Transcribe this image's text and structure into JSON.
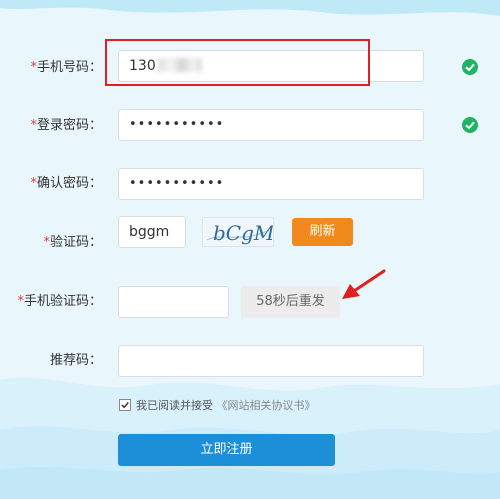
{
  "form": {
    "phone": {
      "required_mark": "*",
      "label": "手机号码：",
      "value_prefix": "130"
    },
    "password": {
      "required_mark": "*",
      "label": "登录密码：",
      "value": "•••••••••••"
    },
    "confirm": {
      "required_mark": "*",
      "label": "确认密码：",
      "value": "•••••••••••"
    },
    "captcha": {
      "required_mark": "*",
      "label": "验证码：",
      "value": "bggm",
      "image_text": "bCgM",
      "refresh_label": "刷新"
    },
    "sms": {
      "required_mark": "*",
      "label": "手机验证码：",
      "value": "",
      "resend_label": "58秒后重发"
    },
    "referral": {
      "label": "推荐码：",
      "value": ""
    },
    "agreement": {
      "checked": true,
      "text": "我已阅读并接受",
      "link": "《网站相关协议书》"
    },
    "submit_label": "立即注册"
  },
  "colors": {
    "required": "#e4393c",
    "valid_check": "#1fb463",
    "refresh_button": "#f08a1d",
    "submit_button": "#1d8fd9",
    "highlight_box": "#e02020",
    "annotation_arrow": "#e02020"
  },
  "icons": [
    "check-circle-icon",
    "checkbox-checked-icon",
    "annotation-arrow-icon"
  ]
}
